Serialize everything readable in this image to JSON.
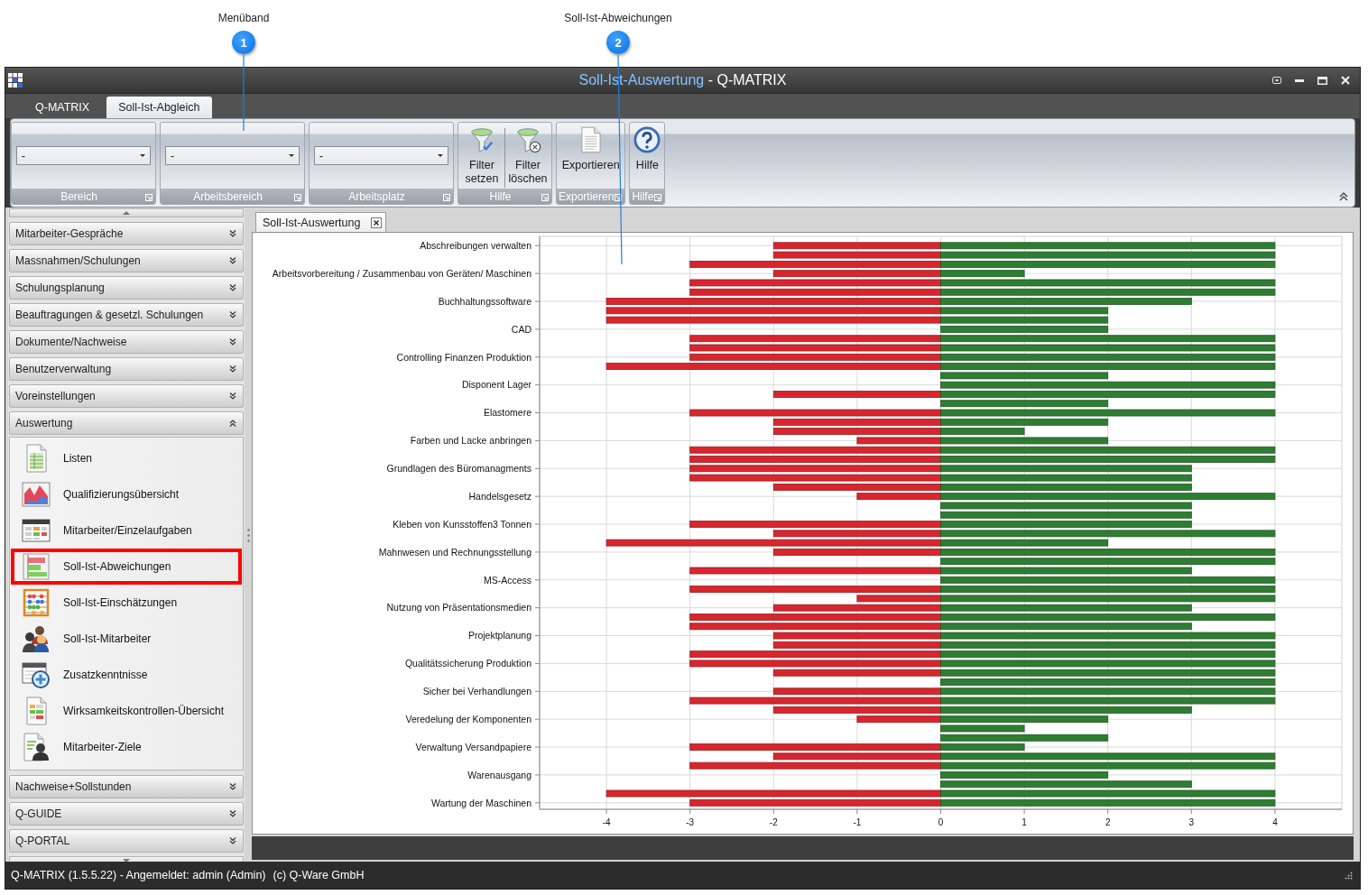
{
  "callouts": [
    {
      "number": "1",
      "label": "Menüband"
    },
    {
      "number": "2",
      "label": "Soll-Ist-Abweichungen"
    }
  ],
  "window": {
    "title": {
      "document": "Soll-Ist-Auswertung",
      "app": "- Q-MATRIX"
    }
  },
  "ribbon": {
    "tabs": [
      {
        "label": "Q-MATRIX",
        "selected": false
      },
      {
        "label": "Soll-Ist-Abgleich",
        "selected": true
      }
    ],
    "groups": [
      {
        "kind": "dropdown",
        "value": "-",
        "label": "Bereich"
      },
      {
        "kind": "dropdown",
        "value": "-",
        "label": "Arbeitsbereich"
      },
      {
        "kind": "dropdown",
        "value": "-",
        "label": "Arbeitsplatz"
      },
      {
        "kind": "buttons",
        "label": "Hilfe",
        "buttons": [
          {
            "label": "Filter setzen"
          },
          {
            "label": "Filter löschen"
          }
        ]
      },
      {
        "kind": "buttons",
        "label": "Exportieren",
        "buttons": [
          {
            "label": "Exportieren"
          }
        ]
      },
      {
        "kind": "buttons",
        "label": "Hilfe",
        "buttons": [
          {
            "label": "Hilfe"
          }
        ]
      }
    ]
  },
  "sidebar": {
    "sections": [
      {
        "label": "Mitarbeiter-Gespräche",
        "expanded": false
      },
      {
        "label": "Massnahmen/Schulungen",
        "expanded": false
      },
      {
        "label": "Schulungsplanung",
        "expanded": false
      },
      {
        "label": "Beauftragungen & gesetzl. Schulungen",
        "expanded": false
      },
      {
        "label": "Dokumente/Nachweise",
        "expanded": false
      },
      {
        "label": "Benutzerverwaltung",
        "expanded": false
      },
      {
        "label": "Voreinstellungen",
        "expanded": false
      },
      {
        "label": "Auswertung",
        "expanded": true,
        "items": [
          {
            "label": "Listen",
            "highlighted": false
          },
          {
            "label": "Qualifizierungsübersicht",
            "highlighted": false
          },
          {
            "label": "Mitarbeiter/Einzelaufgaben",
            "highlighted": false
          },
          {
            "label": "Soll-Ist-Abweichungen",
            "highlighted": true
          },
          {
            "label": "Soll-Ist-Einschätzungen",
            "highlighted": false
          },
          {
            "label": "Soll-Ist-Mitarbeiter",
            "highlighted": false
          },
          {
            "label": "Zusatzkenntnisse",
            "highlighted": false
          },
          {
            "label": "Wirksamkeitskontrollen-Übersicht",
            "highlighted": false
          },
          {
            "label": "Mitarbeiter-Ziele",
            "highlighted": false
          }
        ]
      },
      {
        "label": "Nachweise+Sollstunden",
        "expanded": false
      },
      {
        "label": "Q-GUIDE",
        "expanded": false
      },
      {
        "label": "Q-PORTAL",
        "expanded": false
      }
    ]
  },
  "document": {
    "tab": {
      "label": "Soll-Ist-Auswertung"
    },
    "chart_data": {
      "type": "bar",
      "orientation": "horizontal",
      "stacked": true,
      "grid": true,
      "categories": [
        "Abschreibungen verwalten",
        null,
        null,
        "Arbeitsvorbereitung / Zusammenbau von Geräten/ Maschinen",
        null,
        null,
        "Buchhaltungssoftware",
        null,
        null,
        "CAD",
        null,
        null,
        "Controlling Finanzen Produktion",
        null,
        null,
        "Disponent Lager",
        null,
        null,
        "Elastomere",
        null,
        null,
        "Farben und Lacke anbringen",
        null,
        null,
        "Grundlagen des Büromanagments",
        null,
        null,
        "Handelsgesetz",
        null,
        null,
        "Kleben von Kunsstoffen3 Tonnen",
        null,
        null,
        "Mahnwesen und Rechnungsstellung",
        null,
        null,
        "MS-Access",
        null,
        null,
        "Nutzung von Präsentationsmedien",
        null,
        null,
        "Projektplanung",
        null,
        null,
        "Qualitätssicherung Produktion",
        null,
        null,
        "Sicher bei Verhandlungen",
        null,
        null,
        "Veredelung der Komponenten",
        null,
        null,
        "Verwaltung Versandpapiere",
        null,
        null,
        "Warenausgang",
        null,
        null,
        "Wartung der Maschinen"
      ],
      "xlim": [
        -4.8,
        4.8
      ],
      "xticks": [
        -4,
        -3,
        -2,
        -1,
        0,
        1,
        2,
        3,
        4
      ],
      "series": [
        {
          "color": "#d8262e",
          "values": [
            -2,
            -2,
            -3,
            -2,
            -3,
            -3,
            -4,
            -4,
            -4,
            0,
            -3,
            -3,
            -3,
            -4,
            0,
            0,
            -2,
            0,
            -3,
            -2,
            -2,
            -1,
            -3,
            -3,
            -3,
            -3,
            -2,
            -1,
            0,
            0,
            -3,
            -2,
            -4,
            -2,
            0,
            -3,
            0,
            -3,
            -1,
            -2,
            -3,
            -3,
            -2,
            -2,
            -3,
            -3,
            -2,
            0,
            -2,
            -3,
            -2,
            -1,
            0,
            0,
            -3,
            -2,
            -3,
            0,
            0,
            -4,
            -3
          ]
        },
        {
          "color": "#2e7d32",
          "values": [
            4,
            4,
            4,
            1,
            4,
            4,
            3,
            2,
            2,
            2,
            4,
            4,
            4,
            4,
            2,
            4,
            4,
            2,
            4,
            2,
            1,
            2,
            4,
            4,
            3,
            3,
            3,
            4,
            3,
            3,
            3,
            4,
            2,
            4,
            4,
            3,
            4,
            4,
            4,
            3,
            4,
            3,
            4,
            4,
            4,
            4,
            4,
            4,
            4,
            4,
            3,
            2,
            1,
            2,
            1,
            4,
            4,
            2,
            3,
            4,
            4
          ]
        }
      ]
    }
  },
  "status_bar": {
    "session": "Q-MATRIX (1.5.5.22) - Angemeldet: admin (Admin)",
    "copyright": "(c) Q-Ware GmbH"
  }
}
